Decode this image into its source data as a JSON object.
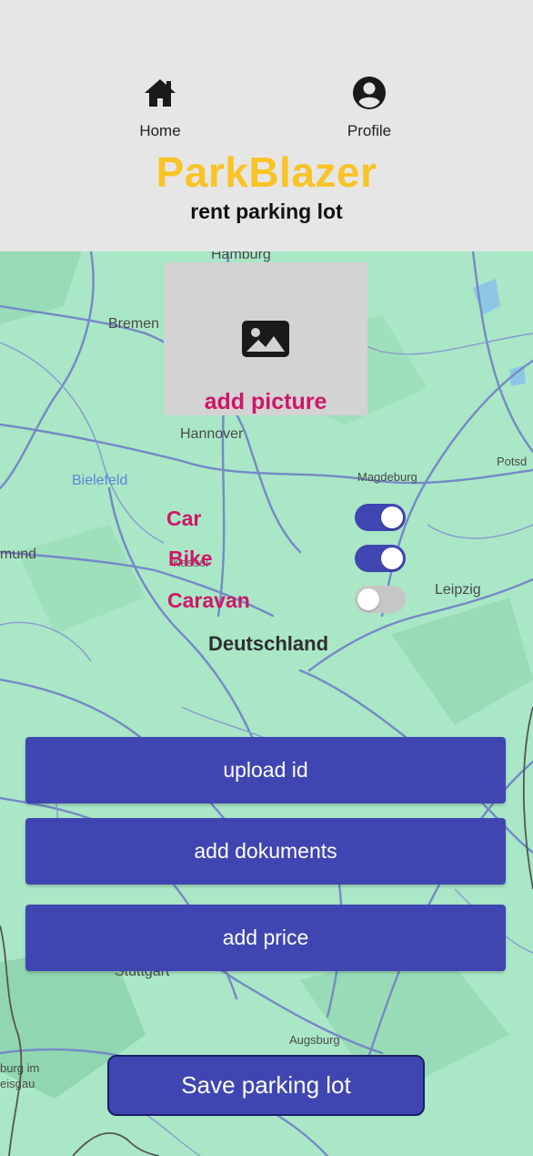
{
  "nav": {
    "home_label": "Home",
    "profile_label": "Profile",
    "home_icon": "home-icon",
    "profile_icon": "profile-icon"
  },
  "brand": {
    "title": "ParkBlazer",
    "subtitle": "rent parking lot",
    "title_color": "#fac326"
  },
  "map": {
    "cities": {
      "hamburg": "Hamburg",
      "bremen": "Bremen",
      "hannover": "Hannover",
      "bielefeld": "Bielefeld",
      "magdeburg": "Magdeburg",
      "potsdam": "Potsd",
      "dortmund": "mund",
      "kassel": "Kassel",
      "leipzig": "Leipzig",
      "country": "Deutschland",
      "stuttgart": "Stuttgart",
      "augsburg": "Augsburg",
      "freiburg_line1": "burg im",
      "freiburg_line2": "eisgau"
    }
  },
  "picture": {
    "label": "add picture",
    "icon": "image-icon"
  },
  "vehicles": [
    {
      "label": "Car",
      "enabled": true
    },
    {
      "label": "Bike",
      "enabled": true
    },
    {
      "label": "Caravan",
      "enabled": false
    }
  ],
  "actions": {
    "upload_id": "upload id",
    "add_documents": "add dokuments",
    "add_price": "add price",
    "save": "Save parking lot"
  },
  "colors": {
    "accent": "#4046b1",
    "label": "#cf1668",
    "map_land": "#a9e7c7"
  }
}
